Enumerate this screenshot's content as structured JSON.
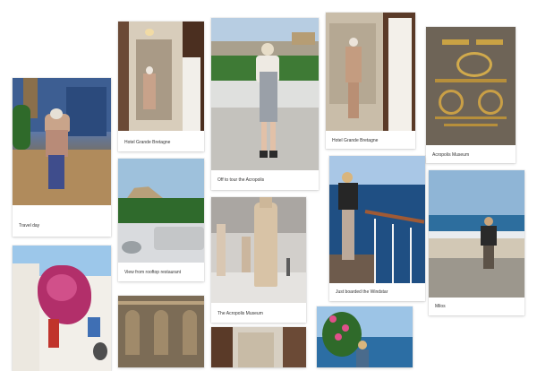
{
  "gallery": {
    "captions": {
      "travel_day": "Travel day",
      "hotel_1": "Hotel Grande Bretagne",
      "acropolis_off": "Off to tour the Acropolis",
      "hotel_2": "Hotel Grande Bretagne",
      "museum_1": "Acropolis Museum",
      "rooftop": "View from rooftop restaurant",
      "boarded": "Just boarded the Windstar",
      "museum_2": "The Acropolis Museum",
      "milos": "Milos"
    }
  }
}
